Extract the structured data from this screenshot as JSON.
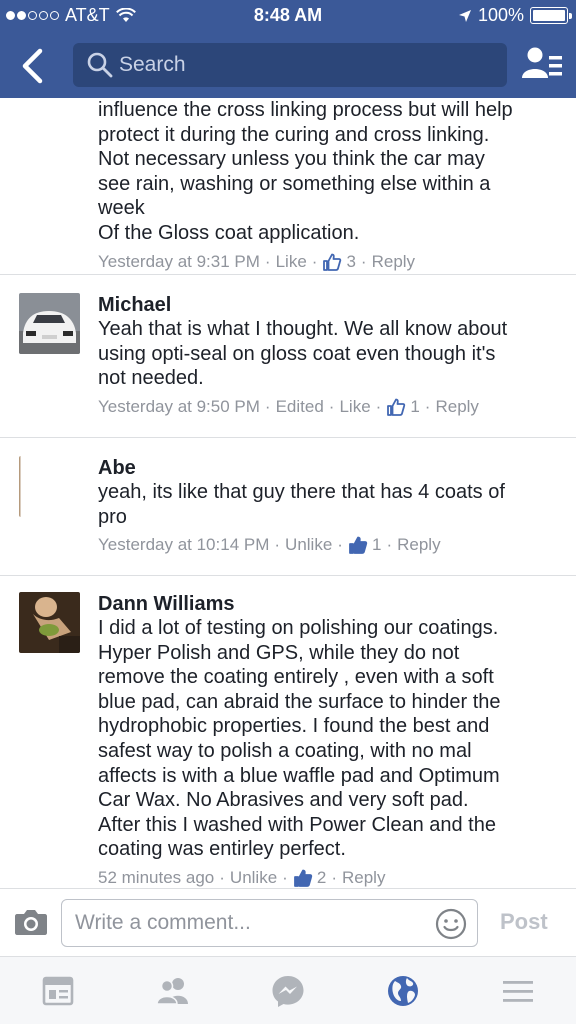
{
  "status_bar": {
    "carrier": "AT&T",
    "time": "8:48 AM",
    "battery": "100%",
    "battery_level": 1.0
  },
  "nav": {
    "search_placeholder": "Search",
    "back_icon": "chevron-left-icon",
    "friends_icon": "friend-requests-icon"
  },
  "comments": [
    {
      "author": "",
      "text": "influence the cross linking process but will help\nprotect it during the curing and cross linking.\nNot necessary unless you think the car may\nsee rain, washing or something else within a\nweek\nOf the Gloss coat application.",
      "time": "Yesterday at 9:31 PM",
      "actions": [
        "Like"
      ],
      "like_count": "3",
      "reply": "Reply"
    },
    {
      "author": "Michael",
      "text": "Yeah that is what I thought. We all know about\nusing opti-seal on gloss coat even though it's\nnot needed.",
      "time": "Yesterday at 9:50 PM",
      "actions": [
        "Edited",
        "Like"
      ],
      "like_count": "1",
      "reply": "Reply"
    },
    {
      "author": "Abe",
      "text": "yeah, its like that guy there that has 4 coats of\npro",
      "time": "Yesterday at 10:14 PM",
      "actions": [
        "Unlike"
      ],
      "like_count": "1",
      "reply": "Reply"
    },
    {
      "author": "Dann Williams",
      "text": "I did a lot of testing on polishing our coatings.\nHyper Polish and GPS, while they do not\nremove the coating entirely , even with a soft\nblue pad, can abraid the surface to hinder the\nhydrophobic properties. I found the best and\nsafest way to polish a coating, with no mal\naffects is with a blue waffle pad and Optimum\nCar Wax. No Abrasives and very soft pad.\nAfter this I washed with Power Clean and the\ncoating was entirley perfect.",
      "time": "52 minutes ago",
      "actions": [
        "Unlike"
      ],
      "like_count": "2",
      "reply": "Reply"
    }
  ],
  "composer": {
    "placeholder": "Write a comment...",
    "post_label": "Post"
  },
  "tabs": [
    "news-feed-icon",
    "friends-icon",
    "messenger-icon",
    "globe-notifications-icon",
    "menu-icon"
  ],
  "colors": {
    "brand": "#3b5998",
    "link_blue": "#4267b2",
    "meta_gray": "#90949c"
  }
}
